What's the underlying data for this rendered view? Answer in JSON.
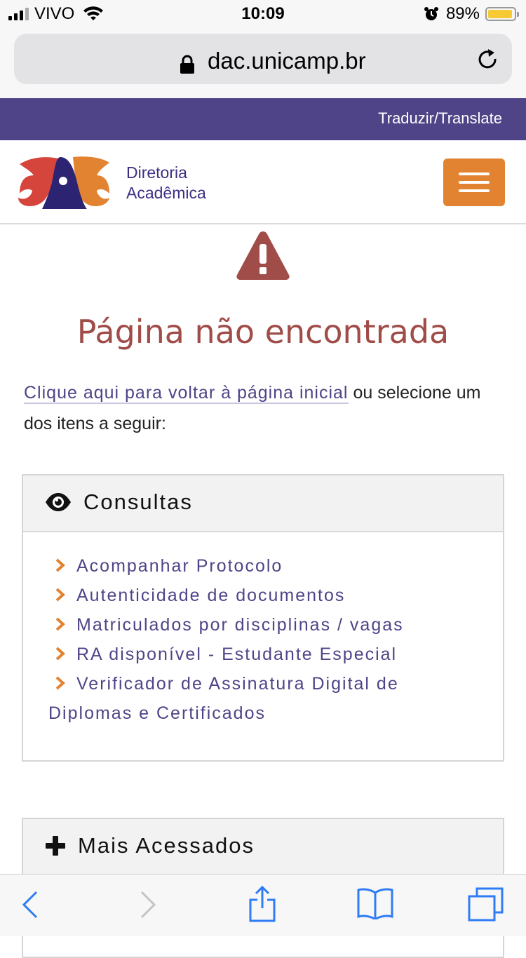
{
  "status_bar": {
    "carrier": "VIVO",
    "time": "10:09",
    "battery": "89%"
  },
  "browser": {
    "url": "dac.unicamp.br"
  },
  "header": {
    "translate_link": "Traduzir/Translate",
    "logo_line1": "Diretoria",
    "logo_line2": "Acadêmica"
  },
  "main": {
    "title": "Página não encontrada",
    "intro_link": "Clique aqui para voltar à página inicial",
    "intro_rest": " ou selecione um dos itens a seguir:"
  },
  "consultas": {
    "heading": "Consultas",
    "items": [
      "Acompanhar Protocolo",
      "Autenticidade de documentos",
      "Matriculados por disciplinas / vagas",
      "RA disponível - Estudante Especial",
      "Verificador de Assinatura Digital de",
      "Diplomas e Certificados"
    ]
  },
  "mais_acessados": {
    "heading": "Mais Acessados"
  },
  "colors": {
    "brand_purple": "#4f4487",
    "accent_orange": "#e28331",
    "error_red": "#a04c48"
  },
  "icons": [
    "signal-icon",
    "wifi-icon",
    "alarm-icon",
    "battery-icon",
    "lock-icon",
    "reload-icon",
    "menu-icon",
    "warning-icon",
    "eye-icon",
    "chevron-right-icon",
    "plus-icon",
    "back-icon",
    "forward-icon",
    "share-icon",
    "bookmarks-icon",
    "tabs-icon"
  ]
}
